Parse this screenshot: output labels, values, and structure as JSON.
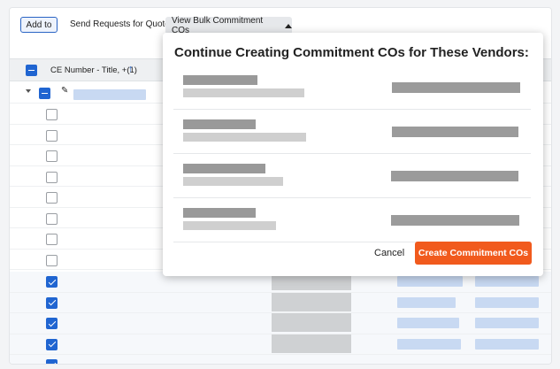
{
  "toolbar": {
    "add_to_label": "Add to",
    "send_rfq_label": "Send Requests for Quote",
    "bulk_label": "View Bulk Commitment COs"
  },
  "table": {
    "column_header": "CE Number - Title, +(1)",
    "sort_icon": "arrow-up-icon",
    "rows_checked": [
      false,
      false,
      false,
      false,
      false,
      false,
      false,
      false,
      true,
      true,
      true,
      true
    ]
  },
  "dialog": {
    "title": "Continue Creating Commitment COs for These Vendors:",
    "cancel_label": "Cancel",
    "create_label": "Create Commitment COs",
    "create_color": "#f15a1d"
  },
  "colors": {
    "accent": "#2065d1",
    "primary_action": "#f15a1d"
  }
}
